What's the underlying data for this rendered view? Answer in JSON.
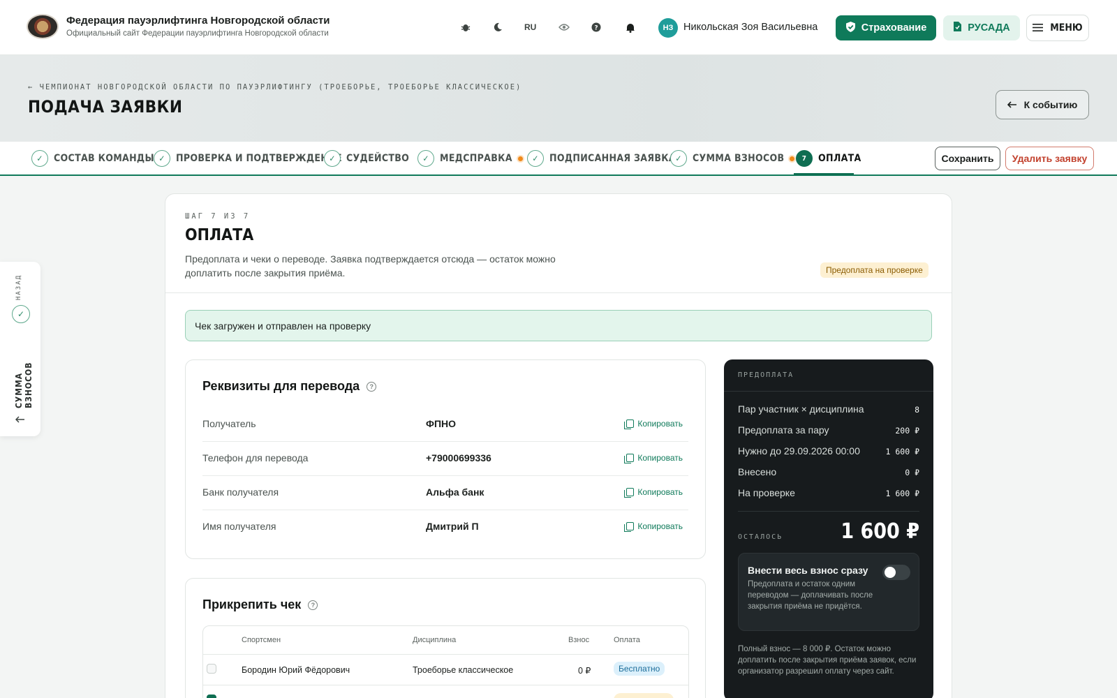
{
  "header": {
    "org_title": "Федерация пауэрлифтинга Новгородской области",
    "org_subtitle": "Официальный сайт Федерации пауэрлифтинга Новгородской области",
    "lang": "RU",
    "avatar_initials": "НЗ",
    "user_name": "Никольская Зоя Васильевна",
    "insurance_label": "Страхование",
    "rusada_label": "РУСАДА",
    "menu_label": "МЕНЮ",
    "icons": [
      "bug-icon",
      "moon-icon",
      "eye-icon",
      "help-icon",
      "bell-icon"
    ]
  },
  "hero": {
    "breadcrumb": "ЧЕМПИОНАТ НОВГОРОДСКОЙ ОБЛАСТИ ПО ПАУЭРЛИФТИНГУ (ТРОЕБОРЬЕ, ТРОЕБОРЬЕ КЛАССИЧЕСКОЕ)",
    "title": "ПОДАЧА ЗАЯВКИ",
    "to_event_label": "К событию"
  },
  "steps": {
    "items": [
      {
        "label": "СОСТАВ КОМАНДЫ",
        "done": true,
        "dot": false
      },
      {
        "label": "ПРОВЕРКА И ПОДТВЕРЖДЕНИЕ",
        "done": true,
        "dot": false
      },
      {
        "label": "СУДЕЙСТВО",
        "done": true,
        "dot": false
      },
      {
        "label": "МЕДСПРАВКА",
        "done": true,
        "dot": true
      },
      {
        "label": "ПОДПИСАННАЯ ЗАЯВКА",
        "done": true,
        "dot": false
      },
      {
        "label": "СУММА ВЗНОСОВ",
        "done": true,
        "dot": true
      },
      {
        "label": "ОПЛАТА",
        "number": "7",
        "active": true
      }
    ],
    "save_label": "Сохранить",
    "delete_label": "Удалить заявку"
  },
  "sidetab": {
    "back_label": "НАЗАД",
    "label": "СУММА ВЗНОСОВ"
  },
  "card": {
    "step_of": "ШАГ 7 ИЗ 7",
    "title": "ОПЛАТА",
    "description": "Предоплата и чеки о переводе. Заявка подтверждается отсюда — остаток можно доплатить после закрытия приёма.",
    "status_badge": "Предоплата на проверке",
    "alert": "Чек загружен и отправлен на проверку"
  },
  "requisites": {
    "title": "Реквизиты для перевода",
    "copy_label": "Копировать",
    "rows": [
      {
        "label": "Получатель",
        "value": "ФПНО"
      },
      {
        "label": "Телефон для перевода",
        "value": "+79000699336"
      },
      {
        "label": "Банк получателя",
        "value": "Альфа банк"
      },
      {
        "label": "Имя получателя",
        "value": "Дмитрий П"
      }
    ]
  },
  "attach": {
    "title": "Прикрепить чек",
    "columns": [
      "Спортсмен",
      "Дисциплина",
      "Взнос",
      "Оплата"
    ],
    "rows": [
      {
        "athlete": "Бородин Юрий Фёдорович",
        "discipline": "Троеборье классическое",
        "fee": "0 ₽",
        "payment": "Бесплатно",
        "checked": false
      }
    ]
  },
  "prepay": {
    "header": "ПРЕДОПЛАТА",
    "rows": [
      {
        "label": "Пар участник × дисциплина",
        "value": "8"
      },
      {
        "label": "Предоплата за пару",
        "value": "200 ₽"
      },
      {
        "label": "Нужно до 29.09.2026 00:00",
        "value": "1 600 ₽"
      },
      {
        "label": "Внесено",
        "value": "0 ₽"
      },
      {
        "label": "На проверке",
        "value": "1 600 ₽"
      }
    ],
    "remaining_label": "ОСТАЛОСЬ",
    "remaining_value": "1 600 ₽",
    "toggle_title": "Внести весь взнос сразу",
    "toggle_desc": "Предоплата и остаток одним переводом — доплачивать после закрытия приёма не придётся.",
    "toggle_on": false,
    "note": "Полный взнос — 8 000 ₽. Остаток можно доплатить после закрытия приёма заявок, если организатор разрешил оплату через сайт."
  },
  "colors": {
    "primary": "#0f7a5a",
    "dark_panel": "#171b1d",
    "warning_dot": "#f08a1c",
    "danger": "#c2412d"
  }
}
